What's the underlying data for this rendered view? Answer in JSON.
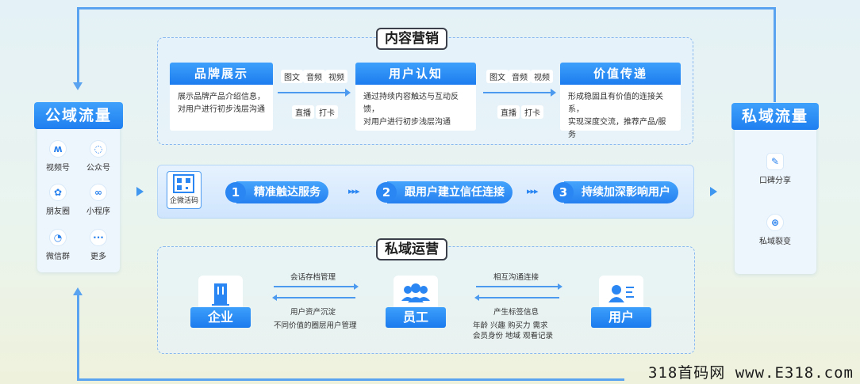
{
  "public_domain": {
    "title": "公域流量",
    "items": [
      {
        "label": "视频号",
        "icon": "channels-icon"
      },
      {
        "label": "公众号",
        "icon": "official-account-icon"
      },
      {
        "label": "朋友圈",
        "icon": "moments-icon"
      },
      {
        "label": "小程序",
        "icon": "mini-program-icon"
      },
      {
        "label": "微信群",
        "icon": "wechat-group-icon"
      },
      {
        "label": "更多",
        "icon": "more-icon"
      }
    ]
  },
  "private_domain": {
    "title": "私域流量",
    "items": [
      {
        "label": "口碑分享",
        "icon": "share-icon"
      },
      {
        "label": "私域裂变",
        "icon": "fission-icon"
      }
    ]
  },
  "content_marketing": {
    "title": "内容营销",
    "cards": [
      {
        "title": "品牌展示",
        "desc1": "展示品牌产品介绍信息，",
        "desc2": "对用户进行初步浅层沟通"
      },
      {
        "title": "用户认知",
        "desc1": "通过持续内容触达与互动反馈，",
        "desc2": "对用户进行初步浅层沟通"
      },
      {
        "title": "价值传递",
        "desc1": "形成稳固且有价值的连接关系，",
        "desc2": "实现深度交流，推荐产品/服务"
      }
    ],
    "tags": {
      "t1": "图文",
      "t2": "音频",
      "t3": "视频",
      "t4": "直播",
      "t5": "打卡"
    }
  },
  "middle_band": {
    "qr_label": "企微活码",
    "steps": [
      {
        "num": "1",
        "label": "精准触达服务"
      },
      {
        "num": "2",
        "label": "跟用户建立信任连接"
      },
      {
        "num": "3",
        "label": "持续加深影响用户"
      }
    ],
    "chevrons": "▸▸▸"
  },
  "private_ops": {
    "title": "私域运营",
    "entities": [
      {
        "label": "企业",
        "icon": "building-icon"
      },
      {
        "label": "员工",
        "icon": "staff-group-icon"
      },
      {
        "label": "用户",
        "icon": "user-card-icon"
      }
    ],
    "left_flow": {
      "top": "会话存档管理",
      "bottom1": "用户资产沉淀",
      "bottom2": "不同价值的圈层用户管理"
    },
    "right_flow": {
      "top": "相互沟通连接",
      "bottom1": "产生标签信息",
      "bottom2": "年龄   兴趣   购买力   需求",
      "bottom3": "会员身份   地域   观看记录"
    }
  },
  "watermark": "318首码网 www.E318.com",
  "colors": {
    "accent": "#2a86f2",
    "accent_light": "#3fa1fb",
    "bg": "#e6f2f6"
  }
}
